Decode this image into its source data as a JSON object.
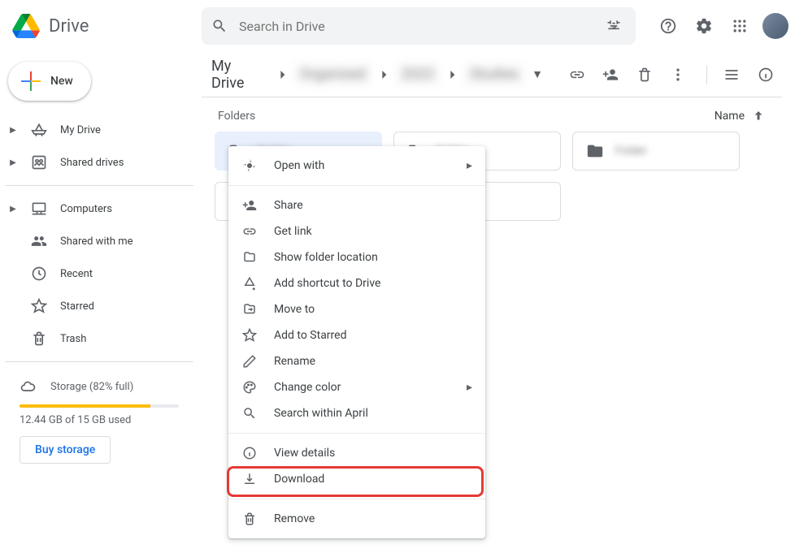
{
  "app": {
    "name": "Drive"
  },
  "search": {
    "placeholder": "Search in Drive"
  },
  "new_button": {
    "label": "New"
  },
  "nav": {
    "my_drive": "My Drive",
    "shared_drives": "Shared drives",
    "computers": "Computers",
    "shared_with_me": "Shared with me",
    "recent": "Recent",
    "starred": "Starred",
    "trash": "Trash"
  },
  "storage": {
    "label": "Storage (82% full)",
    "percent": 82,
    "used_text": "12.44 GB of 15 GB used",
    "buy_label": "Buy storage"
  },
  "breadcrumbs": {
    "root": "My Drive",
    "seg1": "Organized",
    "seg2": "2022",
    "seg3": "Studies"
  },
  "section": {
    "folders_label": "Folders",
    "sort_label": "Name"
  },
  "context_menu": {
    "open_with": "Open with",
    "share": "Share",
    "get_link": "Get link",
    "show_location": "Show folder location",
    "add_shortcut": "Add shortcut to Drive",
    "move_to": "Move to",
    "add_starred": "Add to Starred",
    "rename": "Rename",
    "change_color": "Change color",
    "search_within": "Search within April",
    "view_details": "View details",
    "download": "Download",
    "remove": "Remove"
  }
}
